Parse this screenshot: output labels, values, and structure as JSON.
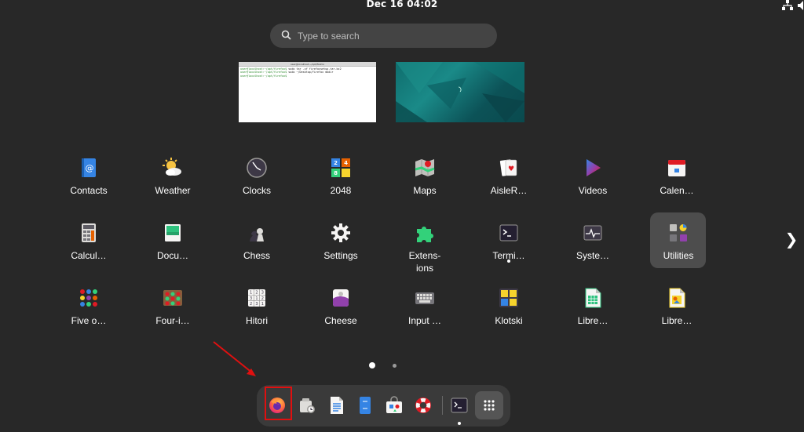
{
  "topbar": {
    "datetime": "Dec 16  04:02",
    "tray_icons": [
      "network-icon",
      "volume-icon"
    ]
  },
  "search": {
    "placeholder": "Type to search"
  },
  "workspaces": {
    "ws1": {
      "terminal_title": "user@localhost:~/opt/firefox",
      "lines": [
        {
          "prompt": "user@localhost:~/opt/firefox$",
          "cmd": " sudo tar -xf firefoxsetup.tar.bz2"
        },
        {
          "prompt": "user@localhost:~/opt/firefox$",
          "cmd": " sudo ~/Desktop/firefox mkdir"
        },
        {
          "prompt": "user@localhost:~/opt/firefox$",
          "cmd": " "
        }
      ]
    }
  },
  "apps": [
    {
      "label": "Contacts",
      "icon": "contacts-icon"
    },
    {
      "label": "Weather",
      "icon": "weather-icon"
    },
    {
      "label": "Clocks",
      "icon": "clocks-icon"
    },
    {
      "label": "2048",
      "icon": "2048-icon"
    },
    {
      "label": "Maps",
      "icon": "maps-icon"
    },
    {
      "label": "AisleR…",
      "icon": "aisleriot-icon"
    },
    {
      "label": "Videos",
      "icon": "videos-icon"
    },
    {
      "label": "Calen…",
      "icon": "calendar-icon"
    },
    {
      "label": "Calcul…",
      "icon": "calculator-icon"
    },
    {
      "label": "Docu…",
      "icon": "document-viewer-icon"
    },
    {
      "label": "Chess",
      "icon": "chess-icon"
    },
    {
      "label": "Settings",
      "icon": "settings-icon"
    },
    {
      "label": "Extens-\nions",
      "icon": "extensions-icon"
    },
    {
      "label": "Termi…",
      "icon": "terminal-icon"
    },
    {
      "label": "Syste…",
      "icon": "system-monitor-icon"
    },
    {
      "label": "Utilities",
      "icon": "utilities-folder-icon"
    },
    {
      "label": "Five o…",
      "icon": "five-or-more-icon"
    },
    {
      "label": "Four-i…",
      "icon": "four-in-a-row-icon"
    },
    {
      "label": "Hitori",
      "icon": "hitori-icon"
    },
    {
      "label": "Cheese",
      "icon": "cheese-icon"
    },
    {
      "label": "Input …",
      "icon": "input-method-icon"
    },
    {
      "label": "Klotski",
      "icon": "klotski-icon"
    },
    {
      "label": "Libre…",
      "icon": "libreoffice-calc-icon"
    },
    {
      "label": "Libre…",
      "icon": "libreoffice-draw-icon"
    }
  ],
  "pagination": {
    "pages": 2,
    "current": 1
  },
  "dock": {
    "items": [
      "firefox-icon",
      "software-updates-icon",
      "text-editor-icon",
      "files-icon",
      "software-store-icon",
      "help-icon",
      "terminal-icon",
      "show-apps-icon"
    ]
  },
  "colors": {
    "background": "#282828",
    "dock": "#3a3a3a",
    "highlight": "#e01010",
    "folder_tile": "#4d4d4d"
  }
}
